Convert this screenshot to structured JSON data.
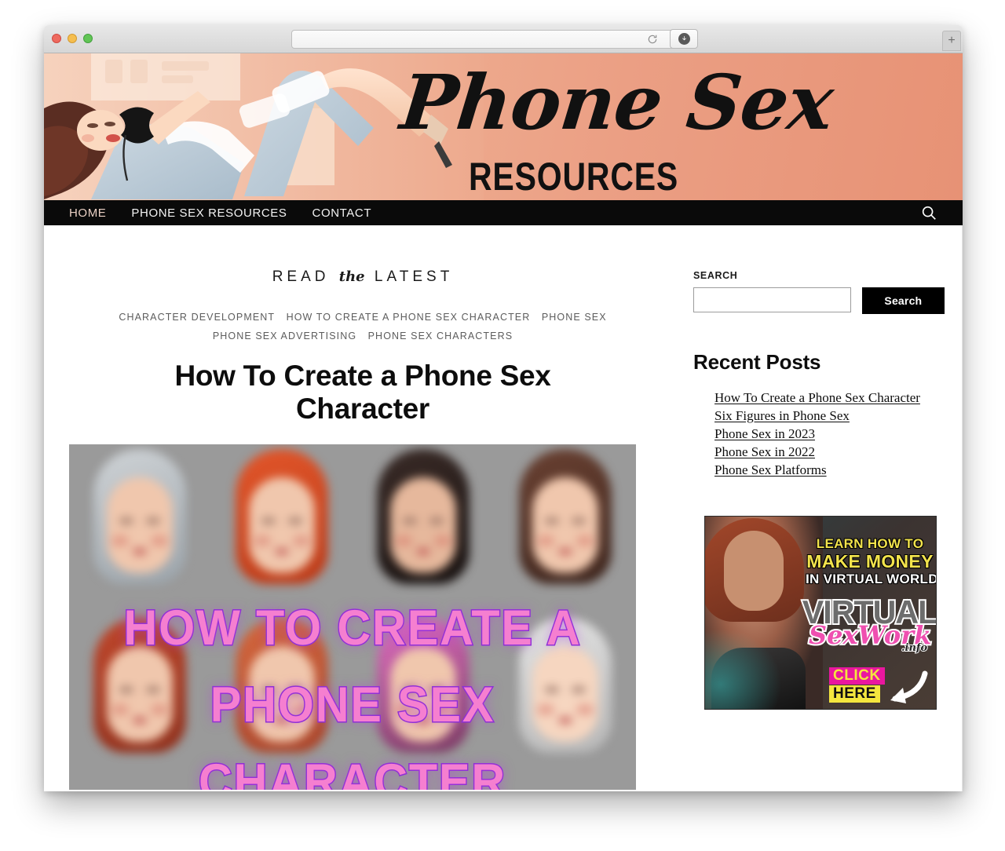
{
  "browser": {
    "url_value": "",
    "url_placeholder": "",
    "reload_icon": "reload-icon",
    "download_icon": "download-icon",
    "newtab_label": "+",
    "traffic_lights": [
      "close",
      "minimize",
      "zoom"
    ],
    "colors": {
      "red": "#ee6a5f",
      "yellow": "#f5be4f",
      "green": "#61c555"
    }
  },
  "site": {
    "logo_script": "Phone Sex",
    "logo_sub": "RESOURCES",
    "banner_bg": "#eb9f84"
  },
  "nav": {
    "items": [
      {
        "label": "HOME",
        "active": true
      },
      {
        "label": "PHONE SEX RESOURCES",
        "active": false
      },
      {
        "label": "CONTACT",
        "active": false
      }
    ],
    "search_icon": "search-icon"
  },
  "main": {
    "section_heading_pre": "READ",
    "section_heading_script": "the",
    "section_heading_post": "LATEST",
    "categories": [
      "CHARACTER DEVELOPMENT",
      "HOW TO CREATE A PHONE SEX CHARACTER",
      "PHONE SEX",
      "PHONE SEX ADVERTISING",
      "PHONE SEX CHARACTERS"
    ],
    "post_title": "How To Create a Phone Sex Character",
    "featured_image": {
      "alt": "blurred portraits of women",
      "overlay_line1": "HOW TO CREATE A",
      "overlay_line2": "PHONE SEX",
      "overlay_line3": "CHARACTER",
      "overlay_text_color": "#f57fd0",
      "overlay_outline_color": "#8b2fd6",
      "background_color": "#9a9a9a"
    }
  },
  "sidebar": {
    "search_label": "SEARCH",
    "search_value": "",
    "search_placeholder": "",
    "search_button": "Search",
    "recent_heading": "Recent Posts",
    "recent_posts": [
      "How To Create a Phone Sex Character",
      "Six Figures in Phone Sex",
      "Phone Sex in 2023",
      "Phone Sex in 2022",
      "Phone Sex Platforms"
    ],
    "ad": {
      "line1": "LEARN HOW TO",
      "line2": "MAKE MONEY",
      "line3": "IN VIRTUAL WORLDS",
      "logo_top": "VIRTUAL",
      "logo_mid": "SexWork",
      "logo_suffix": ".info",
      "cta_top": "CLICK",
      "cta_bottom": "HERE",
      "cta_top_bg": "#e9179f",
      "cta_top_color": "#f4e63e",
      "cta_bottom_bg": "#f4e63e",
      "headline_color": "#f2e34c"
    }
  }
}
